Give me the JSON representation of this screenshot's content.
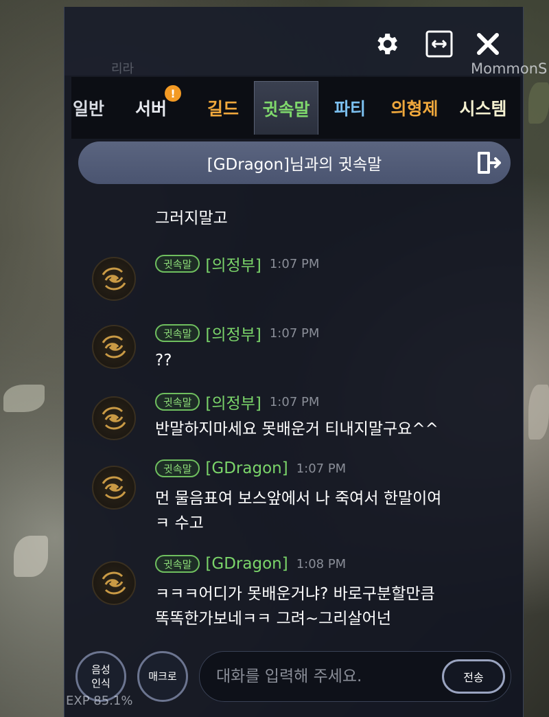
{
  "background": {
    "ghost_player_name": "리라",
    "ghost_right_name": "MommonS",
    "ghost_exp": "EXP 85.1%"
  },
  "toolbar": {
    "settings_icon": "gear-icon",
    "resize_icon": "expand-horizontal-icon",
    "close_icon": "close-icon"
  },
  "tabs": [
    {
      "label": "일반",
      "color": "#d8dbe2"
    },
    {
      "label": "서버",
      "color": "#e8eaf0",
      "badge": "!"
    },
    {
      "label": "길드",
      "color": "#f0a83c"
    },
    {
      "label": "귓속말",
      "color": "#7fd86c",
      "active": true
    },
    {
      "label": "파티",
      "color": "#7cc0f0"
    },
    {
      "label": "의형제",
      "color": "#f0a83c"
    },
    {
      "label": "시스템",
      "color": "#f4f0d0"
    }
  ],
  "conversation": {
    "title": "[GDragon]님과의 귓속말",
    "exit_icon": "exit-door-icon"
  },
  "messages": [
    {
      "partial": true,
      "text": "그러지말고"
    },
    {
      "tag": "귓속말",
      "sender": "[의정부]",
      "time": "1:07 PM",
      "text": ""
    },
    {
      "tag": "귓속말",
      "sender": "[의정부]",
      "time": "1:07 PM",
      "text": "??"
    },
    {
      "tag": "귓속말",
      "sender": "[의정부]",
      "time": "1:07 PM",
      "text": "반말하지마세요 못배운거 티내지말구요^^"
    },
    {
      "tag": "귓속말",
      "sender": "[GDragon]",
      "time": "1:07 PM",
      "text": "먼 물음표여 보스앞에서 나 죽여서 한말이여\nㅋ 수고"
    },
    {
      "tag": "귓속말",
      "sender": "[GDragon]",
      "time": "1:08 PM",
      "text": "ㅋㅋㅋ어디가 못배운거냐? 바로구분할만큼\n똑똑한가보네ㅋㅋ 그려~그리살어넌"
    }
  ],
  "input_bar": {
    "voice_button": "음성\n인식",
    "macro_button": "매크로",
    "placeholder": "대화를 입력해 주세요.",
    "send_button": "전송"
  }
}
